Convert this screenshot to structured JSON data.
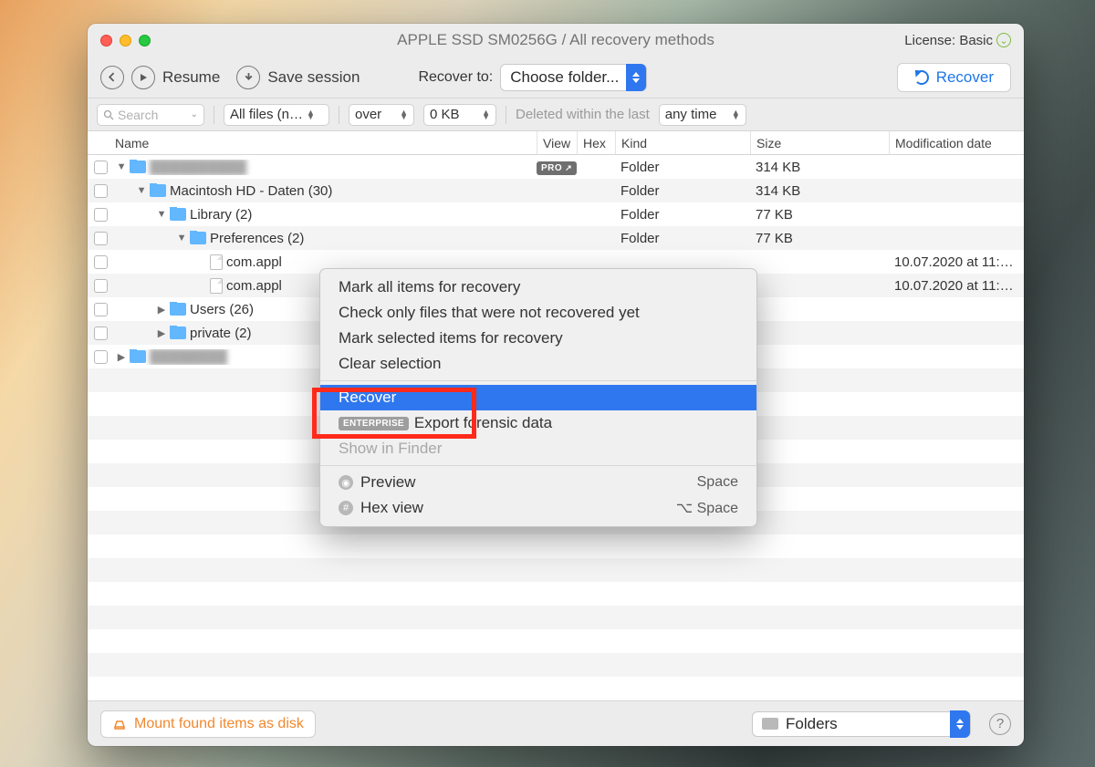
{
  "titlebar": {
    "title": "APPLE SSD SM0256G / All recovery methods"
  },
  "license": {
    "label": "License: Basic"
  },
  "toolbar": {
    "resume": "Resume",
    "save_session": "Save session",
    "recover_to_label": "Recover to:",
    "choose_folder": "Choose folder...",
    "recover_button": "Recover"
  },
  "filters": {
    "search_placeholder": "Search",
    "all_files": "All files (n…",
    "over": "over",
    "size_zero": "0 KB",
    "deleted_label": "Deleted within the last",
    "any_time": "any time"
  },
  "columns": {
    "name": "Name",
    "view": "View",
    "hex": "Hex",
    "kind": "Kind",
    "size": "Size",
    "modification": "Modification date"
  },
  "pro_badge": "PRO",
  "rows": [
    {
      "indent": 0,
      "disclosure": "down",
      "icon": "folder",
      "name_blur": true,
      "name": "██████████",
      "badge": "pro",
      "kind": "Folder",
      "size": "314 KB",
      "mod": ""
    },
    {
      "indent": 1,
      "disclosure": "down",
      "icon": "folder",
      "name": "Macintosh HD - Daten (30)",
      "kind": "Folder",
      "size": "314 KB",
      "mod": ""
    },
    {
      "indent": 2,
      "disclosure": "down",
      "icon": "folder",
      "name": "Library (2)",
      "kind": "Folder",
      "size": "77 KB",
      "mod": ""
    },
    {
      "indent": 3,
      "disclosure": "down",
      "icon": "folder",
      "name": "Preferences (2)",
      "kind": "Folder",
      "size": "77 KB",
      "mod": ""
    },
    {
      "indent": 4,
      "disclosure": "",
      "icon": "file",
      "name": "com.appl",
      "kind": "",
      "size": "",
      "mod": "10.07.2020 at 11:…"
    },
    {
      "indent": 4,
      "disclosure": "",
      "icon": "file",
      "name": "com.appl",
      "kind": "",
      "size": "",
      "mod": "10.07.2020 at 11:…"
    },
    {
      "indent": 2,
      "disclosure": "right",
      "icon": "folder",
      "name": "Users (26)",
      "kind": "",
      "size": "",
      "mod": ""
    },
    {
      "indent": 2,
      "disclosure": "right",
      "icon": "folder",
      "name": "private (2)",
      "kind": "",
      "size": "",
      "mod": ""
    },
    {
      "indent": 0,
      "disclosure": "right",
      "icon": "folder",
      "name_blur": true,
      "name": "████████",
      "kind": "",
      "size": "",
      "mod": ""
    }
  ],
  "context": {
    "mark_all": "Mark all items for recovery",
    "check_not_recovered": "Check only files that were not recovered yet",
    "mark_selected": "Mark selected items for recovery",
    "clear": "Clear selection",
    "recover": "Recover",
    "enterprise_badge": "ENTERPRISE",
    "export_forensic": "Export forensic data",
    "show_finder": "Show in Finder",
    "preview": "Preview",
    "preview_short": "Space",
    "hex": "Hex view",
    "hex_short": "⌥ Space"
  },
  "footer": {
    "mount": "Mount found items as disk",
    "folders": "Folders"
  }
}
